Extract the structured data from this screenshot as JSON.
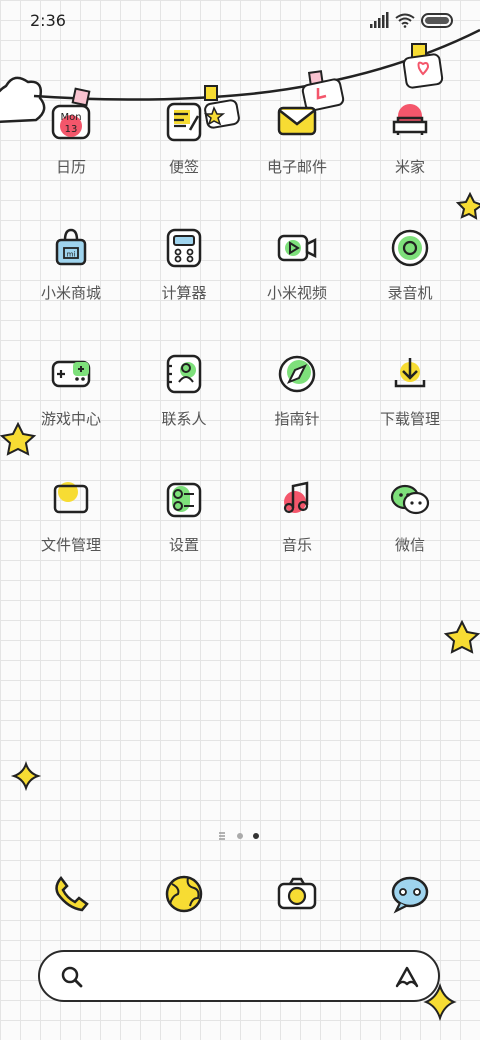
{
  "status_bar": {
    "time": "2:36"
  },
  "apps": [
    {
      "id": "calendar",
      "label": "日历",
      "icon": "calendar-icon",
      "month": "Mon",
      "day": "13"
    },
    {
      "id": "notes",
      "label": "便签",
      "icon": "notes-icon"
    },
    {
      "id": "email",
      "label": "电子邮件",
      "icon": "email-icon"
    },
    {
      "id": "mihome",
      "label": "米家",
      "icon": "mihome-icon"
    },
    {
      "id": "mistore",
      "label": "小米商城",
      "icon": "shopping-bag-icon",
      "brand": "mi"
    },
    {
      "id": "calculator",
      "label": "计算器",
      "icon": "calculator-icon"
    },
    {
      "id": "mivideo",
      "label": "小米视频",
      "icon": "video-icon"
    },
    {
      "id": "recorder",
      "label": "录音机",
      "icon": "recorder-icon"
    },
    {
      "id": "games",
      "label": "游戏中心",
      "icon": "gamepad-icon"
    },
    {
      "id": "contacts",
      "label": "联系人",
      "icon": "contacts-icon"
    },
    {
      "id": "compass",
      "label": "指南针",
      "icon": "compass-icon"
    },
    {
      "id": "downloads",
      "label": "下载管理",
      "icon": "download-icon"
    },
    {
      "id": "files",
      "label": "文件管理",
      "icon": "folder-icon"
    },
    {
      "id": "settings",
      "label": "设置",
      "icon": "settings-icon"
    },
    {
      "id": "music",
      "label": "音乐",
      "icon": "music-icon"
    },
    {
      "id": "wechat",
      "label": "微信",
      "icon": "wechat-icon"
    }
  ],
  "dock": [
    {
      "id": "phone",
      "icon": "phone-icon"
    },
    {
      "id": "browser",
      "icon": "globe-icon"
    },
    {
      "id": "camera",
      "icon": "camera-icon"
    },
    {
      "id": "messages",
      "icon": "messages-icon"
    }
  ],
  "page_indicator": {
    "total_dots": 2,
    "active_index": 1
  },
  "colors": {
    "yellow": "#f7dc33",
    "green": "#7ee07b",
    "red": "#f4566b",
    "blue": "#9fd4ee",
    "ink": "#222222"
  }
}
